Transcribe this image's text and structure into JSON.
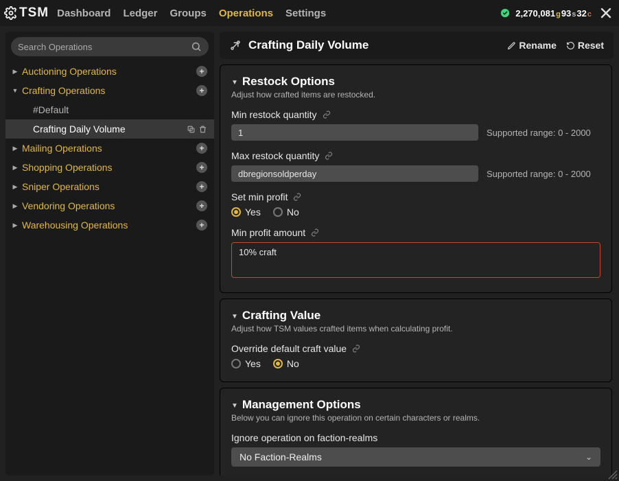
{
  "app": {
    "name": "TSM"
  },
  "nav": {
    "items": [
      "Dashboard",
      "Ledger",
      "Groups",
      "Operations",
      "Settings"
    ],
    "active": "Operations"
  },
  "money": {
    "gold": "2,270,081",
    "g": "g",
    "silver": "93",
    "s": "s",
    "copper": "32",
    "c": "c"
  },
  "sidebar": {
    "search_placeholder": "Search Operations",
    "categories": [
      {
        "label": "Auctioning Operations",
        "expanded": false
      },
      {
        "label": "Crafting Operations",
        "expanded": true,
        "children": [
          {
            "label": "#Default",
            "selected": false
          },
          {
            "label": "Crafting Daily Volume",
            "selected": true
          }
        ]
      },
      {
        "label": "Mailing Operations",
        "expanded": false
      },
      {
        "label": "Shopping Operations",
        "expanded": false
      },
      {
        "label": "Sniper Operations",
        "expanded": false
      },
      {
        "label": "Vendoring Operations",
        "expanded": false
      },
      {
        "label": "Warehousing Operations",
        "expanded": false
      }
    ]
  },
  "header": {
    "title": "Crafting Daily Volume",
    "rename": "Rename",
    "reset": "Reset"
  },
  "restock": {
    "title": "Restock Options",
    "desc": "Adjust how crafted items are restocked.",
    "min_label": "Min restock quantity",
    "min_value": "1",
    "min_hint": "Supported range: 0 - 2000",
    "max_label": "Max restock quantity",
    "max_value": "dbregionsoldperday",
    "max_hint": "Supported range: 0 - 2000",
    "set_min_profit_label": "Set min profit",
    "yes": "Yes",
    "no": "No",
    "set_min_profit": "yes",
    "min_profit_label": "Min profit amount",
    "min_profit_value": "10% craft"
  },
  "crafting_value": {
    "title": "Crafting Value",
    "desc": "Adjust how TSM values crafted items when calculating profit.",
    "override_label": "Override default craft value",
    "yes": "Yes",
    "no": "No",
    "override": "no"
  },
  "management": {
    "title": "Management Options",
    "desc": "Below you can ignore this operation on certain characters or realms.",
    "ignore_label": "Ignore operation on faction-realms",
    "ignore_value": "No Faction-Realms"
  }
}
